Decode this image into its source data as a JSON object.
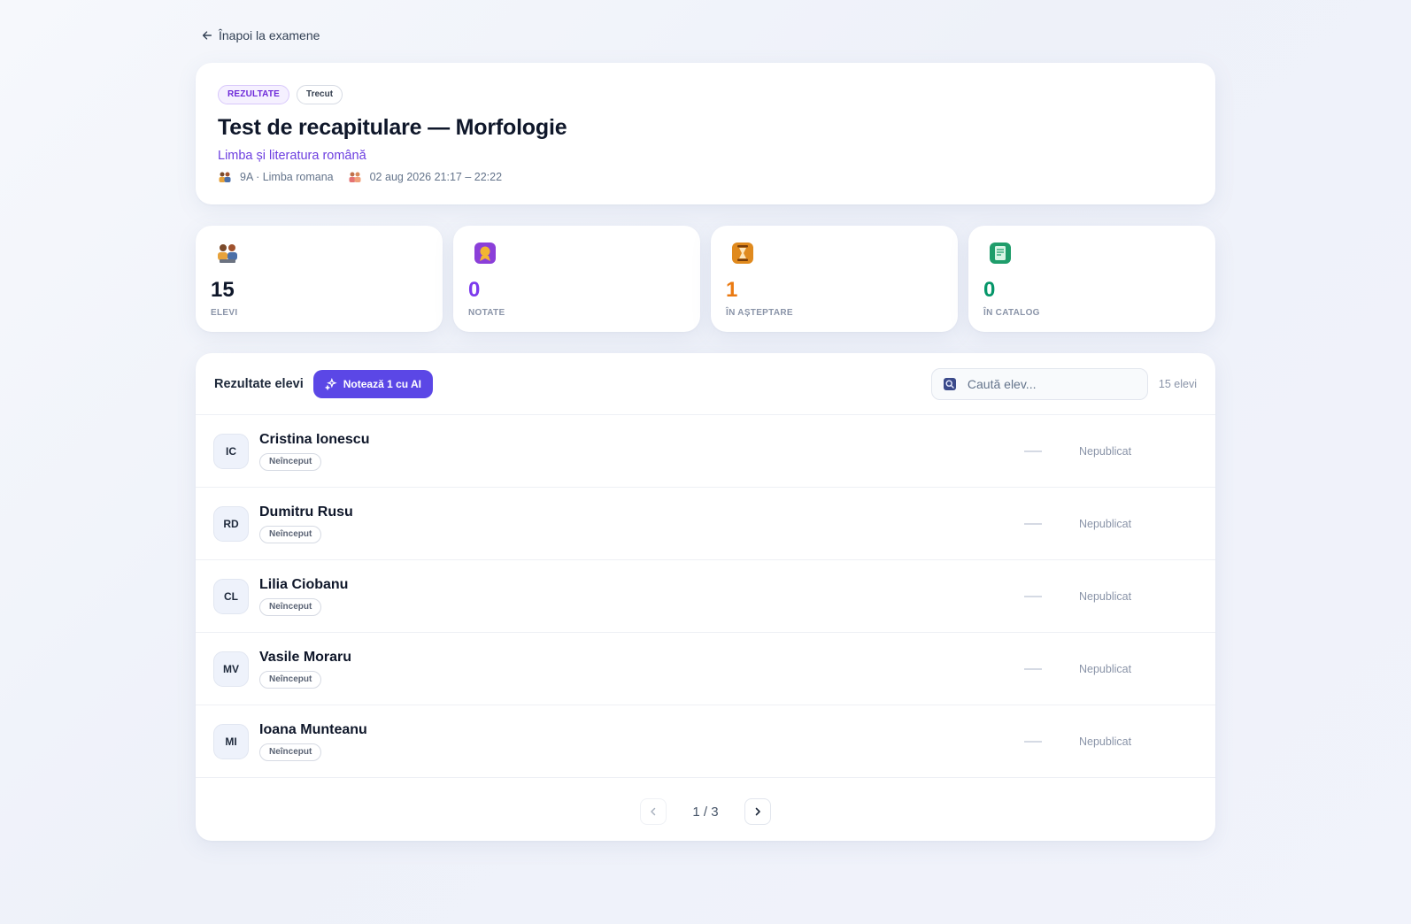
{
  "nav": {
    "back_label": "Înapoi la examene"
  },
  "exam": {
    "tags": [
      "REZULTATE",
      "Trecut"
    ],
    "title": "Test de recapitulare — Morfologie",
    "subject": "Limba și literatura română",
    "class_info": "9A · Limba romana",
    "datetime": "02 aug 2026 21:17 – 22:22"
  },
  "stats": [
    {
      "value": "15",
      "label": "ELEVI",
      "color": "#0f172a",
      "icon": "students-icon"
    },
    {
      "value": "0",
      "label": "NOTATE",
      "color": "#7c3aed",
      "icon": "medal-icon"
    },
    {
      "value": "1",
      "label": "ÎN AȘTEPTARE",
      "color": "#ea7a12",
      "icon": "hourglass-icon"
    },
    {
      "value": "0",
      "label": "ÎN CATALOG",
      "color": "#059669",
      "icon": "ledger-icon"
    }
  ],
  "results": {
    "title": "Rezultate elevi",
    "ai_button": "Notează 1 cu AI",
    "search_placeholder": "Caută elev...",
    "count": "15 elevi",
    "students": [
      {
        "initials": "IC",
        "name": "Cristina Ionescu",
        "status": "Neînceput",
        "publication": "Nepublicat"
      },
      {
        "initials": "RD",
        "name": "Dumitru Rusu",
        "status": "Neînceput",
        "publication": "Nepublicat"
      },
      {
        "initials": "CL",
        "name": "Lilia Ciobanu",
        "status": "Neînceput",
        "publication": "Nepublicat"
      },
      {
        "initials": "MV",
        "name": "Vasile Moraru",
        "status": "Neînceput",
        "publication": "Nepublicat"
      },
      {
        "initials": "MI",
        "name": "Ioana Munteanu",
        "status": "Neînceput",
        "publication": "Nepublicat"
      }
    ],
    "pagination": "1 / 3"
  }
}
